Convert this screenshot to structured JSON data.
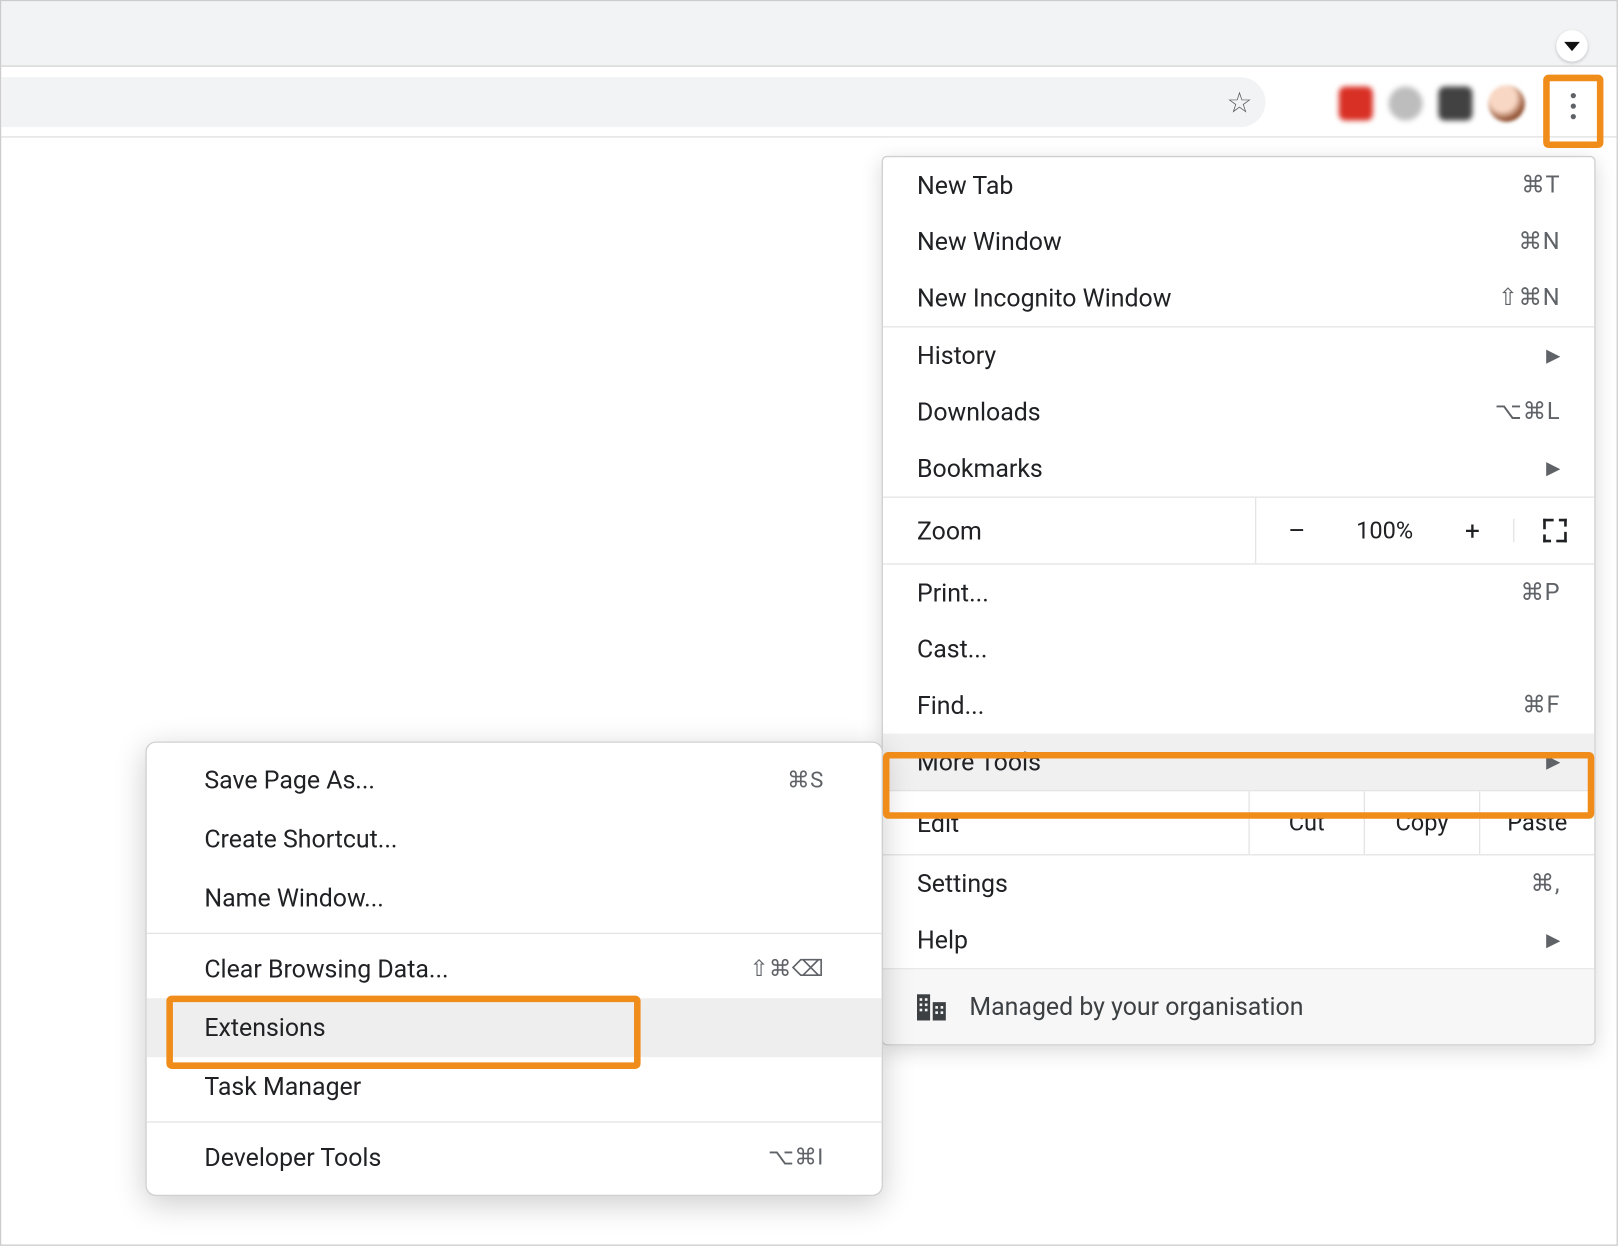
{
  "toolbar": {
    "star_glyph": "☆",
    "more_button_name": "more-options"
  },
  "main_menu": {
    "group1": [
      {
        "label": "New Tab",
        "shortcut": "⌘T"
      },
      {
        "label": "New Window",
        "shortcut": "⌘N"
      },
      {
        "label": "New Incognito Window",
        "shortcut": "⇧⌘N"
      }
    ],
    "group2": [
      {
        "label": "History",
        "submenu": true
      },
      {
        "label": "Downloads",
        "shortcut": "⌥⌘L"
      },
      {
        "label": "Bookmarks",
        "submenu": true
      }
    ],
    "zoom": {
      "label": "Zoom",
      "minus": "–",
      "value": "100%",
      "plus": "+"
    },
    "group3": [
      {
        "label": "Print...",
        "shortcut": "⌘P"
      },
      {
        "label": "Cast..."
      },
      {
        "label": "Find...",
        "shortcut": "⌘F"
      },
      {
        "label": "More Tools",
        "submenu": true,
        "highlighted": true
      }
    ],
    "edit": {
      "label": "Edit",
      "cut": "Cut",
      "copy": "Copy",
      "paste": "Paste"
    },
    "group4": [
      {
        "label": "Settings",
        "shortcut": "⌘,"
      },
      {
        "label": "Help",
        "submenu": true
      }
    ],
    "managed": "Managed by your organisation"
  },
  "submenu": {
    "group1": [
      {
        "label": "Save Page As...",
        "shortcut": "⌘S"
      },
      {
        "label": "Create Shortcut..."
      },
      {
        "label": "Name Window..."
      }
    ],
    "group2": [
      {
        "label": "Clear Browsing Data...",
        "shortcut": "⇧⌘⌫"
      },
      {
        "label": "Extensions",
        "highlighted": true
      },
      {
        "label": "Task Manager"
      }
    ],
    "group3": [
      {
        "label": "Developer Tools",
        "shortcut": "⌥⌘I"
      }
    ]
  }
}
